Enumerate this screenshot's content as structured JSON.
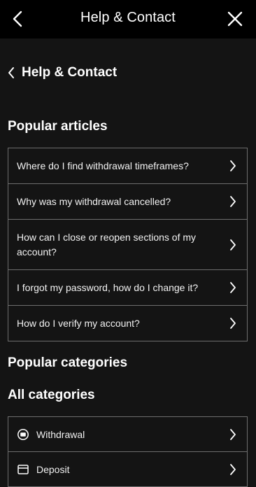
{
  "header": {
    "title": "Help & Contact",
    "back_icon": "chevron-left-icon",
    "close_icon": "close-icon"
  },
  "breadcrumb": {
    "label": "Help & Contact"
  },
  "popular_articles": {
    "title": "Popular articles",
    "items": [
      {
        "label": "Where do I find withdrawal timeframes?"
      },
      {
        "label": "Why was my withdrawal cancelled?"
      },
      {
        "label": "How can I close or reopen sections of my account?"
      },
      {
        "label": "I forgot my password, how do I change it?"
      },
      {
        "label": "How do I verify my account?"
      }
    ]
  },
  "popular_categories": {
    "title": "Popular categories"
  },
  "all_categories": {
    "title": "All categories",
    "items": [
      {
        "label": "Withdrawal",
        "icon": "withdrawal-icon"
      },
      {
        "label": "Deposit",
        "icon": "deposit-icon"
      }
    ]
  }
}
